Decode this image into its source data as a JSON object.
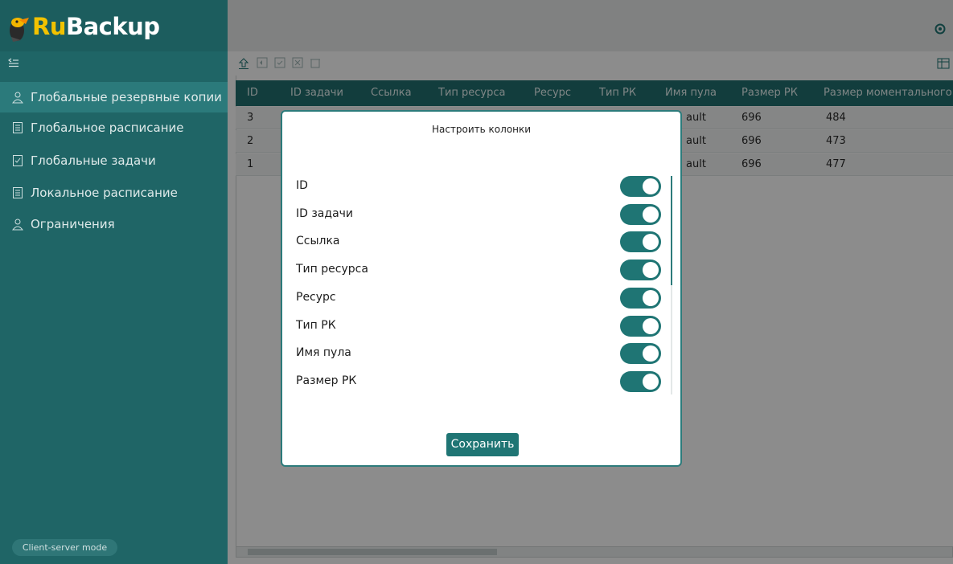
{
  "app": {
    "logo_part1": "Ru",
    "logo_part2": "Backup",
    "mode_label": "Client-server mode"
  },
  "sidebar": {
    "items": [
      {
        "label": "Глобальные резервные копии",
        "icon": "user-icon",
        "active": true
      },
      {
        "label": "Глобальное расписание",
        "icon": "document-icon"
      },
      {
        "label": "Глобальные задачи",
        "icon": "checklist-icon"
      },
      {
        "label": "Локальное расписание",
        "icon": "document-icon"
      },
      {
        "label": "Ограничения",
        "icon": "user-icon"
      }
    ]
  },
  "table": {
    "columns": [
      "ID",
      "ID задачи",
      "Ссылка",
      "Тип ресурса",
      "Ресурс",
      "Тип РК",
      "Имя пула",
      "Размер РК",
      "Размер моментального"
    ],
    "rows": [
      {
        "id": "3",
        "pool_tail": "ault",
        "size": "696",
        "snap": "484"
      },
      {
        "id": "2",
        "pool_tail": "ault",
        "size": "696",
        "snap": "473"
      },
      {
        "id": "1",
        "pool_tail": "ault",
        "size": "696",
        "snap": "477"
      }
    ]
  },
  "dialog": {
    "title": "Настроить колонки",
    "options": [
      {
        "label": "ID",
        "enabled": true
      },
      {
        "label": "ID задачи",
        "enabled": true
      },
      {
        "label": "Ссылка",
        "enabled": true
      },
      {
        "label": "Тип ресурса",
        "enabled": true
      },
      {
        "label": "Ресурс",
        "enabled": true
      },
      {
        "label": "Тип РК",
        "enabled": true
      },
      {
        "label": "Имя пула",
        "enabled": true
      },
      {
        "label": "Размер РК",
        "enabled": true
      }
    ],
    "save_label": "Сохранить"
  },
  "colors": {
    "sidebar": "#1f6566",
    "accent": "#1f7574",
    "logo_yellow": "#f2c200"
  }
}
